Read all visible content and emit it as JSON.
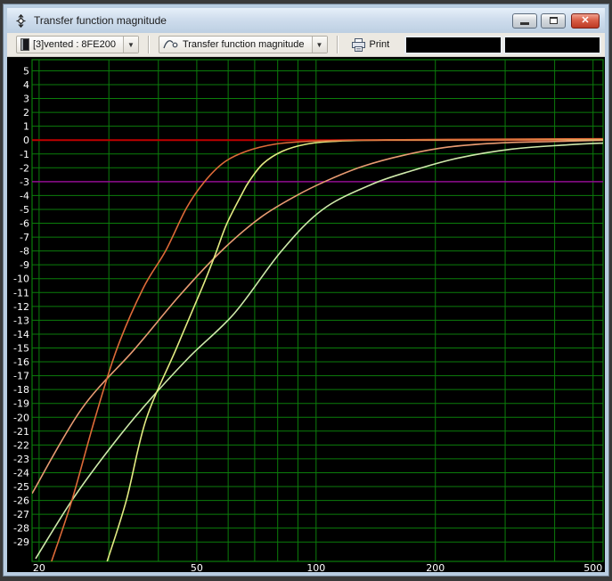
{
  "window": {
    "title": "Transfer function magnitude",
    "controls": {
      "minimize": "minimize",
      "maximize": "maximize",
      "close": "close"
    }
  },
  "toolbar": {
    "project_selector": {
      "value": "[3]vented : 8FE200"
    },
    "plot_selector": {
      "value": "Transfer function magnitude"
    },
    "print_label": "Print",
    "readouts": [
      "",
      ""
    ]
  },
  "chart_data": {
    "type": "line",
    "title": "Transfer function magnitude",
    "background": "#000000",
    "grid_color": "#0b7d0b",
    "label_color": "#ffffff",
    "x_axis": {
      "scale": "log",
      "unit": "Hz",
      "min": 19.2,
      "max": 530,
      "ticks": [
        20,
        50,
        100,
        200,
        500
      ],
      "gridlines": [
        20,
        30,
        40,
        50,
        60,
        70,
        80,
        90,
        100,
        200,
        300,
        400,
        500
      ]
    },
    "y_axis": {
      "unit": "dB",
      "min": -30.4,
      "max": 5.8,
      "tick_min": -29,
      "tick_max": 5,
      "tick_step": 1
    },
    "reference_lines": [
      {
        "value": 0,
        "color": "#c00000",
        "width": 2
      },
      {
        "value": -3,
        "color": "#910b91",
        "width": 1.5
      }
    ],
    "series": [
      {
        "name": "curve-green",
        "color": "#cfe9ab",
        "points": [
          [
            19.6,
            -30.2
          ],
          [
            24.2,
            -26.0
          ],
          [
            29.7,
            -22.5
          ],
          [
            36.6,
            -19.3
          ],
          [
            47.7,
            -15.7
          ],
          [
            62.2,
            -12.5
          ],
          [
            81.8,
            -8.0
          ],
          [
            104,
            -5.0
          ],
          [
            138,
            -3.2
          ],
          [
            175,
            -2.2
          ],
          [
            228,
            -1.3
          ],
          [
            312,
            -0.65
          ],
          [
            427,
            -0.35
          ],
          [
            544,
            -0.2
          ]
        ]
      },
      {
        "name": "curve-salmon",
        "color": "#e89b72",
        "points": [
          [
            19.2,
            -25.5
          ],
          [
            25.6,
            -19.4
          ],
          [
            34.8,
            -15.1
          ],
          [
            45.3,
            -11.2
          ],
          [
            57.7,
            -8.0
          ],
          [
            72.3,
            -5.6
          ],
          [
            89.3,
            -4.0
          ],
          [
            107,
            -2.9
          ],
          [
            131,
            -1.9
          ],
          [
            166,
            -1.1
          ],
          [
            216,
            -0.5
          ],
          [
            294,
            -0.2
          ],
          [
            401,
            -0.1
          ],
          [
            544,
            0
          ]
        ]
      },
      {
        "name": "curve-yellow",
        "color": "#e3ea82",
        "points": [
          [
            29.7,
            -30.4
          ],
          [
            33.2,
            -26.0
          ],
          [
            37.2,
            -20.2
          ],
          [
            44.3,
            -15.1
          ],
          [
            51.5,
            -10.7
          ],
          [
            55.6,
            -8.3
          ],
          [
            59.4,
            -6.1
          ],
          [
            64.7,
            -4.0
          ],
          [
            67.7,
            -3.0
          ],
          [
            73.5,
            -1.7
          ],
          [
            82.3,
            -0.8
          ],
          [
            94.3,
            -0.3
          ],
          [
            110,
            -0.1
          ],
          [
            150,
            0
          ],
          [
            544,
            0.05
          ]
        ]
      },
      {
        "name": "curve-orange",
        "color": "#de6a38",
        "points": [
          [
            21.5,
            -30.4
          ],
          [
            24.2,
            -26.0
          ],
          [
            27.6,
            -20.2
          ],
          [
            31.4,
            -15.1
          ],
          [
            36.6,
            -10.7
          ],
          [
            41.7,
            -8.0
          ],
          [
            47.1,
            -4.9
          ],
          [
            52.3,
            -3.0
          ],
          [
            58.6,
            -1.6
          ],
          [
            66.8,
            -0.8
          ],
          [
            78.5,
            -0.3
          ],
          [
            94.3,
            -0.1
          ],
          [
            128,
            0
          ],
          [
            216,
            0.05
          ],
          [
            544,
            0.1
          ]
        ]
      }
    ]
  }
}
